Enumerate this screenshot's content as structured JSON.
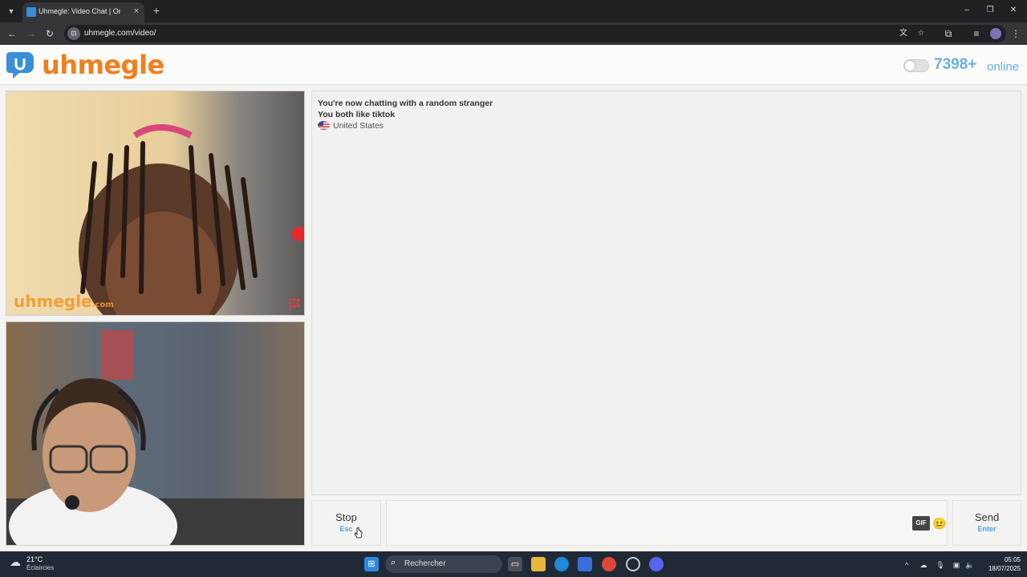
{
  "browser": {
    "tab_title": "Uhmegle: Video Chat | Ome",
    "url": "uhmegle.com/video/"
  },
  "header": {
    "logo_text": "uhmegle",
    "online_count": "7398+",
    "online_label": "online"
  },
  "stranger_video": {
    "watermark": "uhmegle",
    "watermark_suffix": ".com"
  },
  "chat": {
    "messages": [
      "You're now chatting with a random stranger",
      "You both like tiktok"
    ],
    "country": "United States"
  },
  "controls": {
    "stop_label": "Stop",
    "stop_hint": "Esc",
    "send_label": "Send",
    "send_hint": "Enter",
    "gif_label": "GIF",
    "input_value": ""
  },
  "taskbar": {
    "temperature": "21°C",
    "weather": "Éclaircies",
    "search_placeholder": "Rechercher",
    "time": "05:05",
    "date": "18/07/2025"
  },
  "colors": {
    "brand_orange": "#f07f1e",
    "brand_blue": "#3a8fd8",
    "online_blue": "#6aaee6",
    "hint_blue": "#4aa3e0"
  }
}
